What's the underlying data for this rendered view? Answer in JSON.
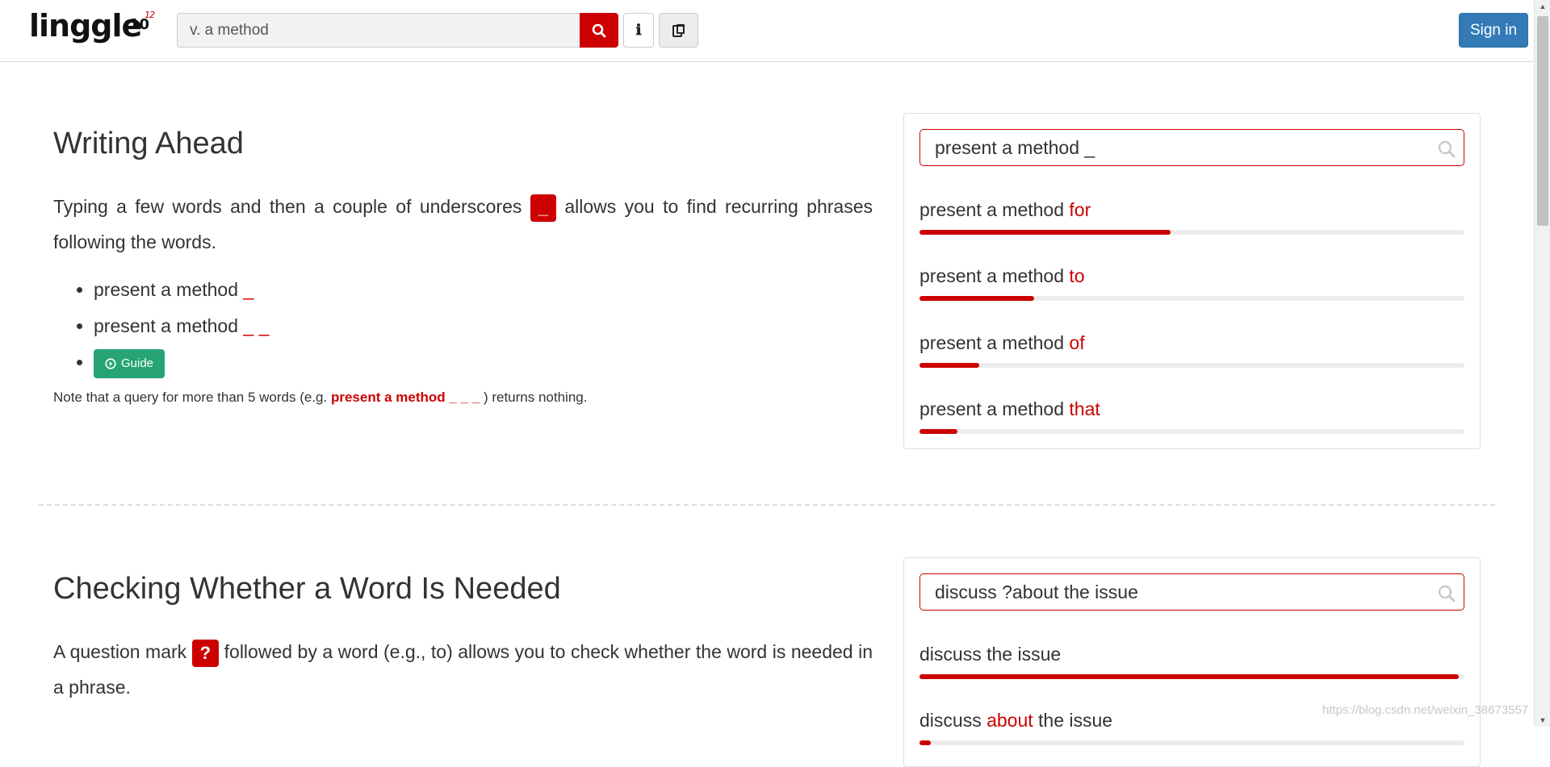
{
  "header": {
    "logo_text": "linggle",
    "logo_power": "10",
    "logo_exponent": "12",
    "search_value": "v. a method",
    "signin_label": "Sign in"
  },
  "section1": {
    "title": "Writing Ahead",
    "para_before": "Typing a few words and then a couple of underscores",
    "badge": "_",
    "para_after": "allows you to find recurring phrases following the words.",
    "bullets": [
      {
        "text": "present a method",
        "suffix": "_"
      },
      {
        "text": "present a method",
        "suffix": "_ _"
      }
    ],
    "guide_label": "Guide",
    "note_before": "Note that a query for more than 5 words (e.g.",
    "note_bold": "present a method _ _ _",
    "note_after": ") returns nothing.",
    "panel": {
      "query": "present a method _",
      "results": [
        {
          "prefix": "present a method",
          "word": "for",
          "fraction": 0.46
        },
        {
          "prefix": "present a method",
          "word": "to",
          "fraction": 0.21
        },
        {
          "prefix": "present a method",
          "word": "of",
          "fraction": 0.11
        },
        {
          "prefix": "present a method",
          "word": "that",
          "fraction": 0.07
        }
      ]
    }
  },
  "section2": {
    "title": "Checking Whether a Word Is Needed",
    "para_before": "A question mark",
    "badge": "?",
    "para_after": "followed by a word (e.g., to) allows you to check whether the word is needed in a phrase.",
    "panel": {
      "query": "discuss ?about the issue",
      "results": [
        {
          "pre": "discuss",
          "word": "",
          "post": "the issue",
          "fraction": 0.99
        },
        {
          "pre": "discuss",
          "word": "about",
          "post": "the issue",
          "fraction": 0.02
        }
      ]
    }
  },
  "watermark": "https://blog.csdn.net/weixin_38673557",
  "colors": {
    "accent": "#cc0000",
    "primary": "#337ab7",
    "guide": "#26a475"
  }
}
